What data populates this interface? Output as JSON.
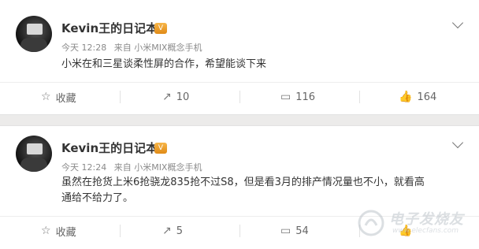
{
  "posts": [
    {
      "username": "Kevin王的日记本",
      "badge": "V",
      "time": "今天 12:28",
      "source": "来自 小米MIX概念手机",
      "text": "小米在和三星谈柔性屏的合作，希望能谈下来",
      "actions": {
        "collect": "收藏",
        "repost": "10",
        "comment": "116",
        "like": "164"
      }
    },
    {
      "username": "Kevin王的日记本",
      "badge": "V",
      "time": "今天 12:24",
      "source": "来自 小米MIX概念手机",
      "text_line1": "虽然在抢货上米6抢骁龙835抢不过S8，但是看3月的排产情况量也不小，就看高",
      "text_line2": "通给不给力了。",
      "actions": {
        "collect": "收藏",
        "repost": "5",
        "comment": "54",
        "like": ""
      }
    }
  ],
  "watermark": {
    "name": "电子发烧友",
    "url": "www.elecfans.com"
  },
  "icons": [
    "star-icon",
    "repost-icon",
    "comment-icon",
    "like-icon",
    "chevron-down-icon"
  ]
}
